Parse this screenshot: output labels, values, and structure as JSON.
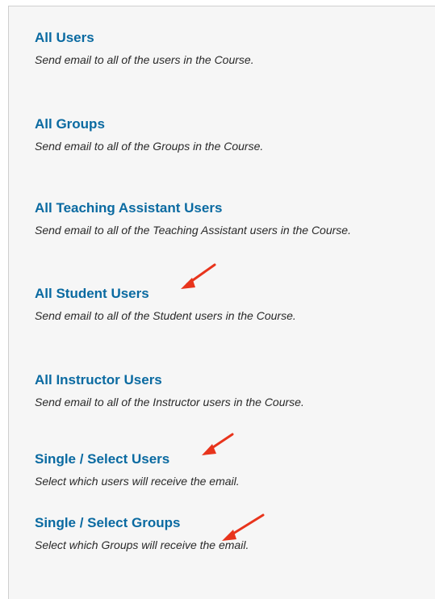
{
  "options": [
    {
      "label": "All Users",
      "description": "Send email to all of the users in the Course."
    },
    {
      "label": "All Groups",
      "description": "Send email to all of the Groups in the Course."
    },
    {
      "label": "All Teaching Assistant Users",
      "description": "Send email to all of the Teaching Assistant users in the Course."
    },
    {
      "label": "All Student Users",
      "description": "Send email to all of the Student users in the Course."
    },
    {
      "label": "All Instructor Users",
      "description": "Send email to all of the Instructor users in the Course."
    },
    {
      "label": "Single / Select Users",
      "description": "Select which users will receive the email."
    },
    {
      "label": "Single / Select Groups",
      "description": "Select which Groups will receive the email."
    }
  ],
  "colors": {
    "link": "#0a6aa1",
    "arrow": "#e8341c",
    "panel_background": "#f6f6f6"
  },
  "annotations": {
    "arrow_icon": "red-arrow-icon",
    "highlighted_options": [
      "All Student Users",
      "Single / Select Users",
      "Single / Select Groups"
    ]
  }
}
